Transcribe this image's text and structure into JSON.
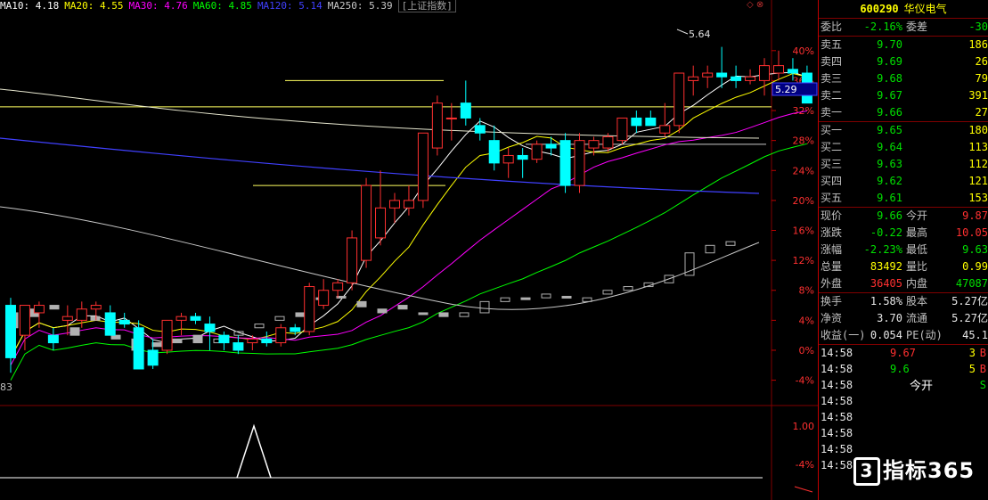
{
  "ma_legend": {
    "ma10": "MA10: 4.18",
    "ma20": "MA20: 4.55",
    "ma30": "MA30: 4.76",
    "ma60": "MA60: 4.85",
    "ma120": "MA120: 5.14",
    "ma250": "MA250: 5.39",
    "index_tab": "[上证指数]"
  },
  "colors": {
    "ma10": "#ffffff",
    "ma20": "#ffff00",
    "ma30": "#ff00ff",
    "ma60": "#00ff00",
    "ma120": "#4040ff",
    "ma250": "#c8c8c8",
    "up": "#ff3030",
    "down": "#00ffff",
    "grid": "#800000"
  },
  "axis": {
    "right_ticks": [
      "40%",
      "36%",
      "32%",
      "28%",
      "24%",
      "20%",
      "16%",
      "12%",
      "8%",
      "4%",
      "0%",
      "-4%"
    ],
    "lower_ticks": [
      "1.00",
      "-4%"
    ],
    "high_label": "5.64",
    "current_label": "5.29",
    "left_low_label": "83"
  },
  "chart_data": {
    "type": "candlestick",
    "ylim": [
      -0.05,
      0.42
    ],
    "candles": [
      {
        "o": 0.06,
        "h": 0.07,
        "l": -0.03,
        "c": -0.01
      },
      {
        "o": 0.02,
        "h": 0.06,
        "l": 0.0,
        "c": 0.06
      },
      {
        "o": 0.05,
        "h": 0.065,
        "l": 0.03,
        "c": 0.06
      },
      {
        "o": 0.02,
        "h": 0.03,
        "l": 0.0,
        "c": 0.01
      },
      {
        "o": 0.04,
        "h": 0.06,
        "l": 0.02,
        "c": 0.045
      },
      {
        "o": 0.04,
        "h": 0.065,
        "l": 0.03,
        "c": 0.055
      },
      {
        "o": 0.055,
        "h": 0.065,
        "l": 0.04,
        "c": 0.06
      },
      {
        "o": 0.05,
        "h": 0.06,
        "l": 0.02,
        "c": 0.02
      },
      {
        "o": 0.04,
        "h": 0.05,
        "l": 0.03,
        "c": 0.035
      },
      {
        "o": 0.03,
        "h": 0.04,
        "l": -0.025,
        "c": -0.025
      },
      {
        "o": 0.0,
        "h": 0.015,
        "l": -0.025,
        "c": -0.02
      },
      {
        "o": 0.0,
        "h": 0.04,
        "l": -0.005,
        "c": 0.04
      },
      {
        "o": 0.04,
        "h": 0.05,
        "l": 0.02,
        "c": 0.045
      },
      {
        "o": 0.045,
        "h": 0.05,
        "l": 0.035,
        "c": 0.04
      },
      {
        "o": 0.035,
        "h": 0.045,
        "l": 0.0,
        "c": 0.025
      },
      {
        "o": 0.02,
        "h": 0.025,
        "l": 0.0,
        "c": 0.01
      },
      {
        "o": 0.01,
        "h": 0.02,
        "l": -0.005,
        "c": 0.0
      },
      {
        "o": 0.01,
        "h": 0.02,
        "l": 0.0,
        "c": 0.015
      },
      {
        "o": 0.015,
        "h": 0.025,
        "l": 0.005,
        "c": 0.01
      },
      {
        "o": 0.01,
        "h": 0.035,
        "l": 0.005,
        "c": 0.03
      },
      {
        "o": 0.03,
        "h": 0.035,
        "l": 0.02,
        "c": 0.025
      },
      {
        "o": 0.025,
        "h": 0.09,
        "l": 0.02,
        "c": 0.085
      },
      {
        "o": 0.06,
        "h": 0.095,
        "l": 0.055,
        "c": 0.08
      },
      {
        "o": 0.08,
        "h": 0.095,
        "l": 0.07,
        "c": 0.09
      },
      {
        "o": 0.09,
        "h": 0.16,
        "l": 0.08,
        "c": 0.15
      },
      {
        "o": 0.12,
        "h": 0.23,
        "l": 0.11,
        "c": 0.22
      },
      {
        "o": 0.15,
        "h": 0.24,
        "l": 0.14,
        "c": 0.19
      },
      {
        "o": 0.19,
        "h": 0.21,
        "l": 0.17,
        "c": 0.2
      },
      {
        "o": 0.19,
        "h": 0.22,
        "l": 0.18,
        "c": 0.2
      },
      {
        "o": 0.2,
        "h": 0.29,
        "l": 0.19,
        "c": 0.29
      },
      {
        "o": 0.27,
        "h": 0.34,
        "l": 0.26,
        "c": 0.33
      },
      {
        "o": 0.31,
        "h": 0.33,
        "l": 0.28,
        "c": 0.31
      },
      {
        "o": 0.33,
        "h": 0.36,
        "l": 0.3,
        "c": 0.31
      },
      {
        "o": 0.3,
        "h": 0.31,
        "l": 0.28,
        "c": 0.29
      },
      {
        "o": 0.28,
        "h": 0.3,
        "l": 0.24,
        "c": 0.25
      },
      {
        "o": 0.25,
        "h": 0.27,
        "l": 0.23,
        "c": 0.26
      },
      {
        "o": 0.26,
        "h": 0.27,
        "l": 0.23,
        "c": 0.255
      },
      {
        "o": 0.255,
        "h": 0.28,
        "l": 0.25,
        "c": 0.275
      },
      {
        "o": 0.275,
        "h": 0.285,
        "l": 0.26,
        "c": 0.27
      },
      {
        "o": 0.28,
        "h": 0.29,
        "l": 0.21,
        "c": 0.22
      },
      {
        "o": 0.22,
        "h": 0.29,
        "l": 0.21,
        "c": 0.28
      },
      {
        "o": 0.27,
        "h": 0.285,
        "l": 0.26,
        "c": 0.28
      },
      {
        "o": 0.27,
        "h": 0.29,
        "l": 0.265,
        "c": 0.285
      },
      {
        "o": 0.28,
        "h": 0.31,
        "l": 0.275,
        "c": 0.31
      },
      {
        "o": 0.31,
        "h": 0.32,
        "l": 0.29,
        "c": 0.3
      },
      {
        "o": 0.31,
        "h": 0.32,
        "l": 0.3,
        "c": 0.3
      },
      {
        "o": 0.29,
        "h": 0.33,
        "l": 0.285,
        "c": 0.3
      },
      {
        "o": 0.3,
        "h": 0.37,
        "l": 0.29,
        "c": 0.37
      },
      {
        "o": 0.36,
        "h": 0.38,
        "l": 0.34,
        "c": 0.365
      },
      {
        "o": 0.365,
        "h": 0.38,
        "l": 0.35,
        "c": 0.37
      },
      {
        "o": 0.37,
        "h": 0.405,
        "l": 0.35,
        "c": 0.365
      },
      {
        "o": 0.365,
        "h": 0.38,
        "l": 0.35,
        "c": 0.36
      },
      {
        "o": 0.36,
        "h": 0.375,
        "l": 0.355,
        "c": 0.365
      },
      {
        "o": 0.36,
        "h": 0.39,
        "l": 0.34,
        "c": 0.38
      },
      {
        "o": 0.37,
        "h": 0.4,
        "l": 0.36,
        "c": 0.38
      },
      {
        "o": 0.375,
        "h": 0.39,
        "l": 0.36,
        "c": 0.37
      },
      {
        "o": 0.37,
        "h": 0.38,
        "l": 0.33,
        "c": 0.33
      }
    ],
    "shadow_candles": [
      {
        "o": 0.05,
        "c": 0.03
      },
      {
        "o": 0.055,
        "c": 0.045
      },
      {
        "o": 0.06,
        "c": 0.055
      },
      {
        "o": 0.03,
        "c": 0.02
      },
      {
        "o": 0.045,
        "c": 0.04
      },
      {
        "o": 0.02,
        "c": 0.015
      },
      {
        "o": 0.015,
        "c": 0.0
      },
      {
        "o": 0.01,
        "c": 0.005
      },
      {
        "o": 0.015,
        "c": 0.01
      },
      {
        "o": 0.02,
        "c": 0.01
      },
      {
        "o": 0.01,
        "c": 0.015
      },
      {
        "o": 0.02,
        "c": 0.025
      },
      {
        "o": 0.03,
        "c": 0.035
      },
      {
        "o": 0.04,
        "c": 0.045
      },
      {
        "o": 0.05,
        "c": 0.045
      },
      {
        "o": 0.07,
        "c": 0.068
      },
      {
        "o": 0.072,
        "c": 0.07
      },
      {
        "o": 0.065,
        "c": 0.058
      },
      {
        "o": 0.055,
        "c": 0.05
      },
      {
        "o": 0.06,
        "c": 0.055
      },
      {
        "o": 0.05,
        "c": 0.048
      },
      {
        "o": 0.05,
        "c": 0.045
      },
      {
        "o": 0.045,
        "c": 0.05
      },
      {
        "o": 0.05,
        "c": 0.065
      },
      {
        "o": 0.065,
        "c": 0.07
      },
      {
        "o": 0.07,
        "c": 0.068
      },
      {
        "o": 0.07,
        "c": 0.075
      },
      {
        "o": 0.072,
        "c": 0.07
      },
      {
        "o": 0.065,
        "c": 0.07
      },
      {
        "o": 0.075,
        "c": 0.08
      },
      {
        "o": 0.08,
        "c": 0.085
      },
      {
        "o": 0.085,
        "c": 0.09
      },
      {
        "o": 0.09,
        "c": 0.1
      },
      {
        "o": 0.1,
        "c": 0.13
      },
      {
        "o": 0.13,
        "c": 0.14
      },
      {
        "o": 0.14,
        "c": 0.145
      }
    ],
    "resistance_levels": [
      0.36,
      0.325,
      0.275,
      0.22
    ],
    "indicator": {
      "peak": 1.0,
      "baseline": -0.04
    }
  },
  "quote": {
    "code": "600290",
    "name": "华仪电气",
    "weibi": {
      "label": "委比",
      "value": "-2.16%",
      "label2": "委差",
      "value2": "-30"
    },
    "sells": [
      {
        "label": "卖五",
        "price": "9.70",
        "vol": "186"
      },
      {
        "label": "卖四",
        "price": "9.69",
        "vol": "26"
      },
      {
        "label": "卖三",
        "price": "9.68",
        "vol": "79"
      },
      {
        "label": "卖二",
        "price": "9.67",
        "vol": "391"
      },
      {
        "label": "卖一",
        "price": "9.66",
        "vol": "27"
      }
    ],
    "buys": [
      {
        "label": "买一",
        "price": "9.65",
        "vol": "180"
      },
      {
        "label": "买二",
        "price": "9.64",
        "vol": "113"
      },
      {
        "label": "买三",
        "price": "9.63",
        "vol": "112"
      },
      {
        "label": "买四",
        "price": "9.62",
        "vol": "121"
      },
      {
        "label": "买五",
        "price": "9.61",
        "vol": "153"
      }
    ],
    "stats": [
      {
        "l1": "现价",
        "v1": "9.66",
        "c1": "green",
        "l2": "今开",
        "v2": "9.87",
        "c2": "red"
      },
      {
        "l1": "涨跌",
        "v1": "-0.22",
        "c1": "green",
        "l2": "最高",
        "v2": "10.05",
        "c2": "red"
      },
      {
        "l1": "涨幅",
        "v1": "-2.23%",
        "c1": "green",
        "l2": "最低",
        "v2": "9.63",
        "c2": "green"
      },
      {
        "l1": "总量",
        "v1": "83492",
        "c1": "yellow",
        "l2": "量比",
        "v2": "0.99",
        "c2": "yellow"
      },
      {
        "l1": "外盘",
        "v1": "36405",
        "c1": "red",
        "l2": "内盘",
        "v2": "47087",
        "c2": "green"
      }
    ],
    "stats2": [
      {
        "l1": "换手",
        "v1": "1.58%",
        "c1": "white",
        "l2": "股本",
        "v2": "5.27亿",
        "c2": "white"
      },
      {
        "l1": "净资",
        "v1": "3.70",
        "c1": "white",
        "l2": "流通",
        "v2": "5.27亿",
        "c2": "white"
      },
      {
        "l1": "收益(一)",
        "v1": "0.054",
        "c1": "white",
        "l2": "PE(动)",
        "v2": "45.1",
        "c2": "white"
      }
    ],
    "ticks": [
      {
        "time": "14:58",
        "price": "9.67",
        "pc": "red",
        "vol": "3",
        "side": "B",
        "sc": "red"
      },
      {
        "time": "14:58",
        "price": "9.6",
        "pc": "green",
        "vol": "5",
        "side": "B",
        "sc": "red"
      },
      {
        "time": "14:58",
        "price": "",
        "pc": "white",
        "vol": "",
        "side": "S",
        "sc": "green"
      },
      {
        "time": "14:58",
        "price": "",
        "pc": "white",
        "vol": "",
        "side": "",
        "sc": "white"
      },
      {
        "time": "14:58",
        "price": "",
        "pc": "white",
        "vol": "",
        "side": "",
        "sc": "white"
      },
      {
        "time": "14:58",
        "price": "",
        "pc": "white",
        "vol": "",
        "side": "",
        "sc": "white"
      },
      {
        "time": "14:58",
        "price": "",
        "pc": "white",
        "vol": "",
        "side": "",
        "sc": "white"
      },
      {
        "time": "14:58",
        "price": "",
        "pc": "white",
        "vol": "",
        "side": "",
        "sc": "white"
      }
    ],
    "popup_label": "今开"
  },
  "watermark": {
    "glyph": "3",
    "text": "指标365"
  }
}
